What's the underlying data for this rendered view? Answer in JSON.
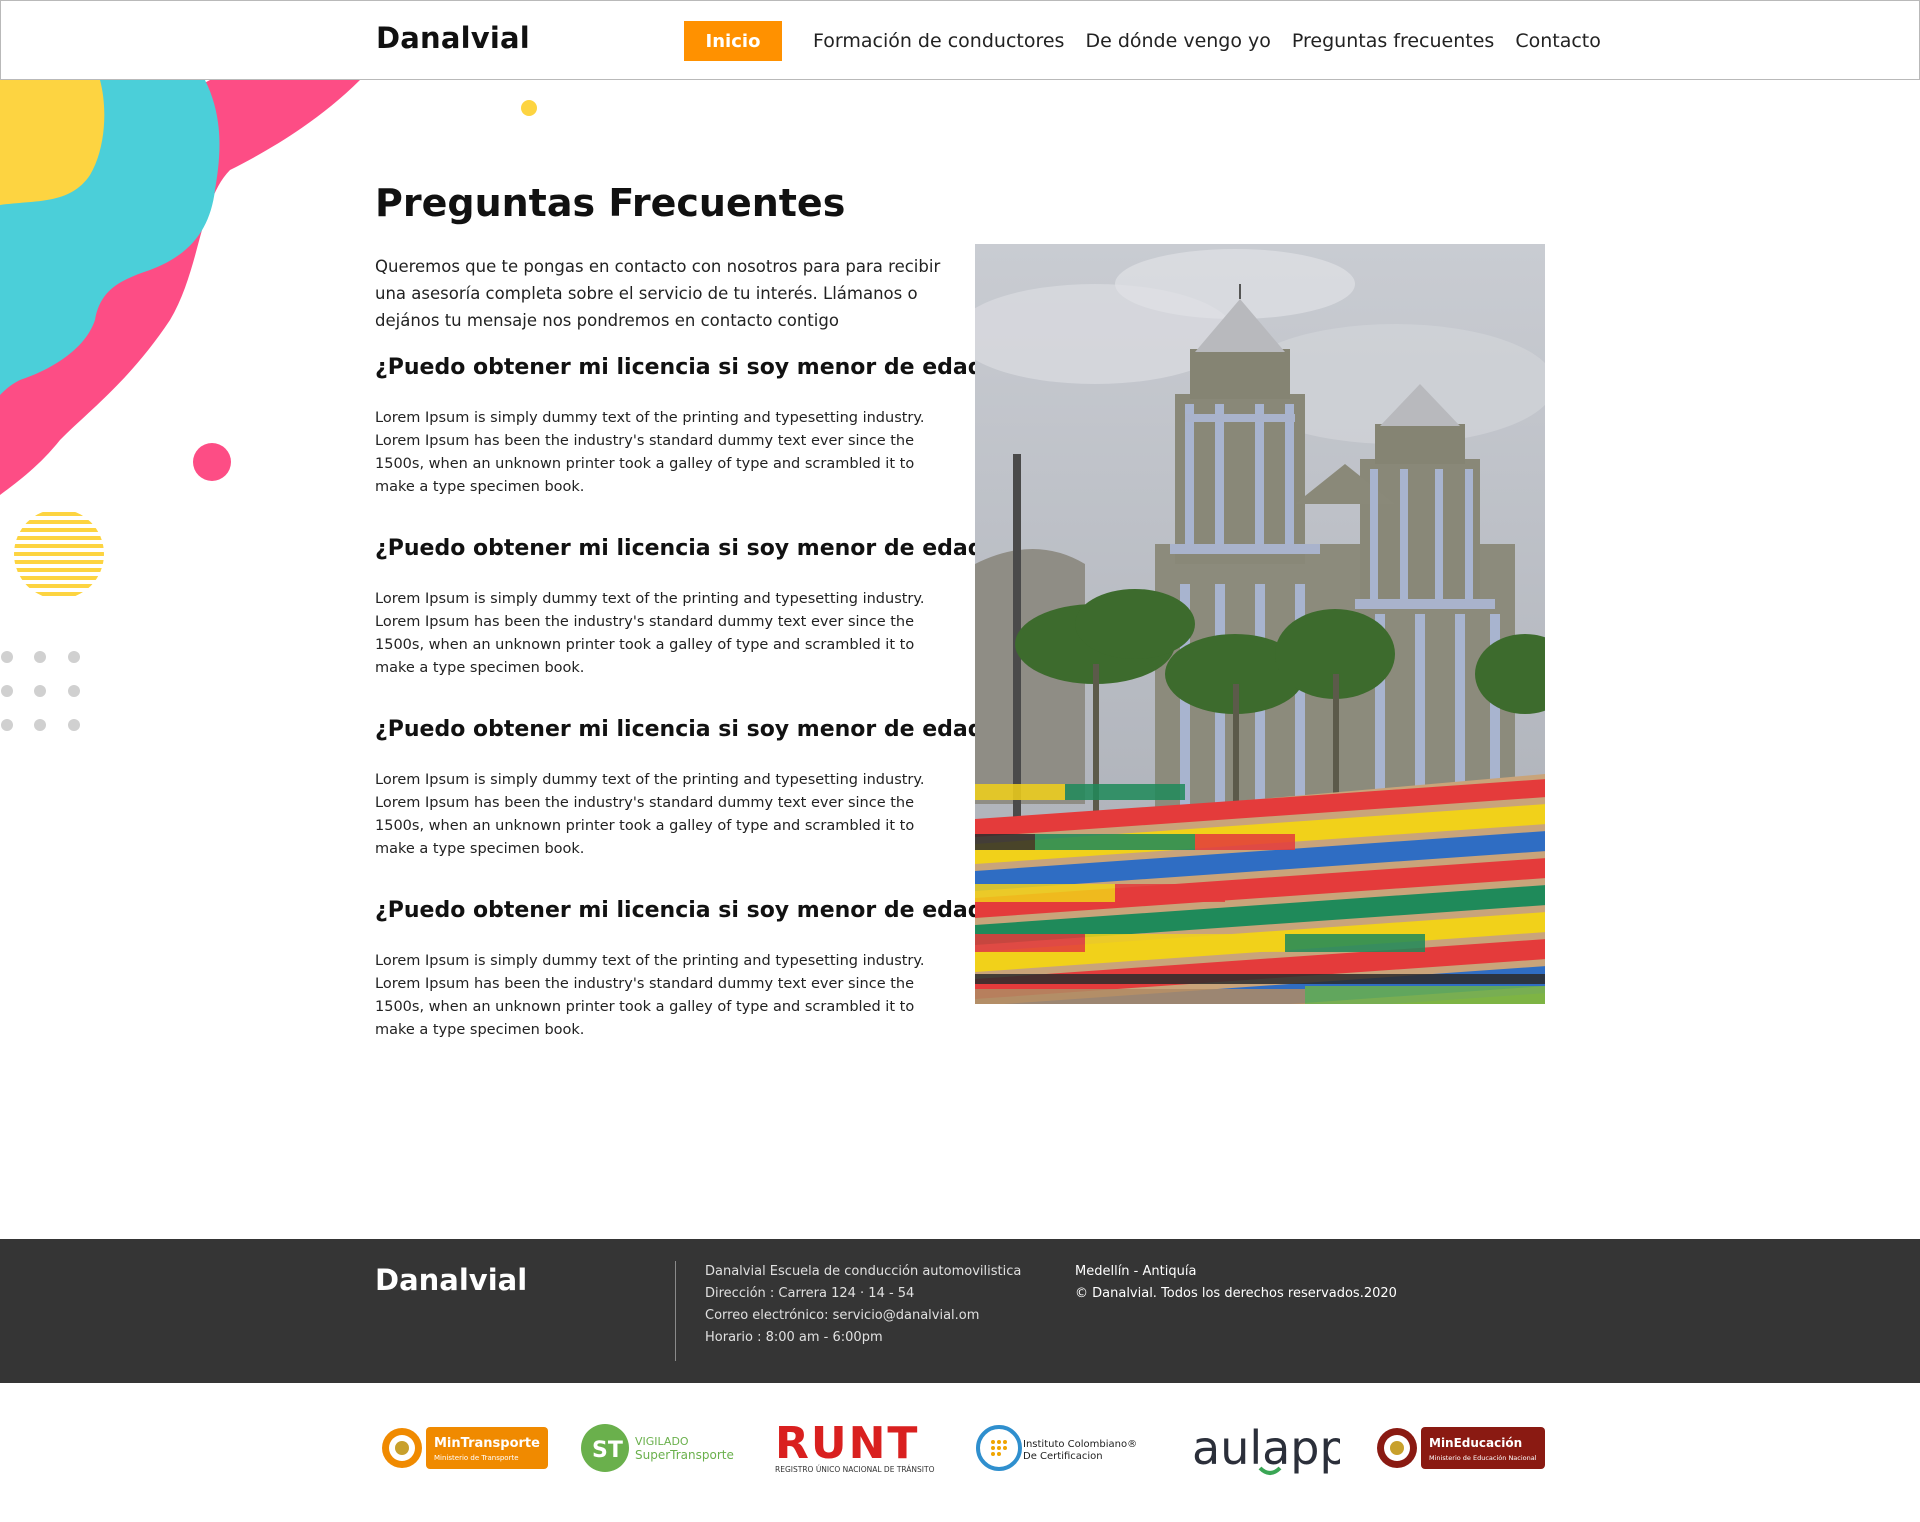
{
  "header": {
    "brand": "Danalvial",
    "nav": [
      {
        "label": "Inicio",
        "active": true
      },
      {
        "label": "Formación de conductores"
      },
      {
        "label": "De dónde vengo yo"
      },
      {
        "label": "Preguntas frecuentes"
      },
      {
        "label": "Contacto"
      }
    ]
  },
  "main": {
    "title": "Preguntas Frecuentes",
    "intro": "Queremos que te pongas en contacto con nosotros para para recibir una asesoría completa sobre el servicio de tu interés. Llámanos o dejános tu mensaje nos pondremos en contacto contigo",
    "faqs": [
      {
        "question": "¿Puedo obtener mi licencia si soy menor de edad?",
        "answer": "Lorem Ipsum is simply dummy text of the printing and typesetting industry. Lorem Ipsum has been the industry's standard dummy text ever since the 1500s, when an unknown printer took a galley of type and scrambled it to make a type specimen book."
      },
      {
        "question": "¿Puedo obtener mi licencia si soy menor de edad?",
        "answer": "Lorem Ipsum is simply dummy text of the printing and typesetting industry. Lorem Ipsum has been the industry's standard dummy text ever since the 1500s, when an unknown printer took a galley of type and scrambled it to make a type specimen book."
      },
      {
        "question": "¿Puedo obtener mi licencia si soy menor de edad?",
        "answer": "Lorem Ipsum is simply dummy text of the printing and typesetting industry. Lorem Ipsum has been the industry's standard dummy text ever since the 1500s, when an unknown printer took a galley of type and scrambled it to make a type specimen book."
      },
      {
        "question": "¿Puedo obtener mi licencia si soy menor de edad?",
        "answer": "Lorem Ipsum is simply dummy text of the printing and typesetting industry. Lorem Ipsum has been the industry's standard dummy text ever since the 1500s, when an unknown printer took a galley of type and scrambled it to make a type specimen book."
      }
    ]
  },
  "footer": {
    "brand": "Danalvial",
    "info": [
      "Danalvial  Escuela de conducción automovilistica",
      "Dirección : Carrera 124 · 14 - 54",
      "Correo electrónico: servicio@danalvial.om",
      "Horario : 8:00 am - 6:00pm"
    ],
    "location": "Medellín - Antiquía",
    "copyright": "© Danalvial. Todos los derechos reservados.2020"
  },
  "logos": {
    "mintransporte": {
      "name": "MinTransporte",
      "sub": "Ministerio de Transporte"
    },
    "supertransporte": {
      "line1": "VIGILADO",
      "line2": "SuperTransporte"
    },
    "runt": {
      "name": "RUNT",
      "sub": "REGISTRO ÚNICO NACIONAL DE TRÁNSITO"
    },
    "icc": {
      "line1": "Instituto Colombiano®",
      "line2": "De Certificacion"
    },
    "aulapp": {
      "name": "aulapp"
    },
    "mineducacion": {
      "name": "MinEducación",
      "sub": "Ministerio de Educación Nacional"
    }
  },
  "colors": {
    "accent": "#ff9100",
    "footer_bg": "#353535",
    "deco_yellow": "#fdd441",
    "deco_cyan": "#4bcfd9",
    "deco_pink": "#fd4d85"
  }
}
